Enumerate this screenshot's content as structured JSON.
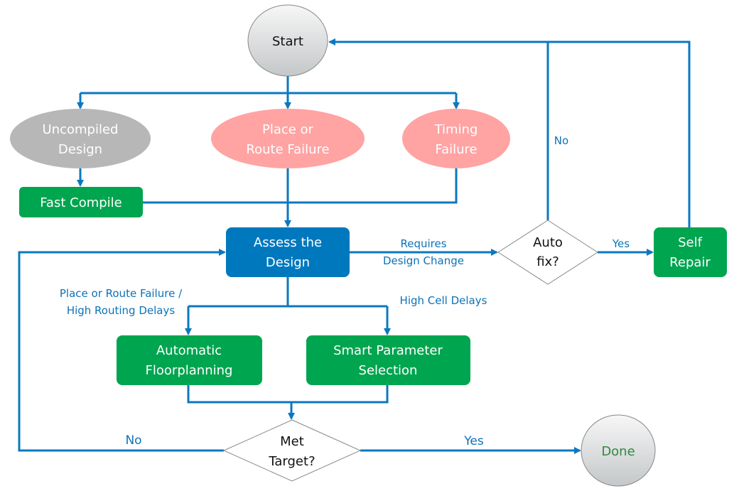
{
  "colors": {
    "connector": "#0a78c0",
    "process_green": "#00a54f",
    "process_blue": "#0078be",
    "failure_pink": "#ffa3a3",
    "uncompiled_gray": "#b7b7b7",
    "done_text": "#2e8b3e"
  },
  "nodes": {
    "start": "Start",
    "uncompiled": [
      "Uncompiled",
      "Design"
    ],
    "place_route_failure": [
      "Place or",
      "Route Failure"
    ],
    "timing_failure": [
      "Timing",
      "Failure"
    ],
    "fast_compile": "Fast Compile",
    "assess": [
      "Assess the",
      "Design"
    ],
    "auto_fix": [
      "Auto",
      "fix?"
    ],
    "self_repair": [
      "Self",
      "Repair"
    ],
    "floorplanning": [
      "Automatic",
      "Floorplanning"
    ],
    "smart_param": [
      "Smart Parameter",
      "Selection"
    ],
    "met_target": [
      "Met",
      "Target?"
    ],
    "done": "Done"
  },
  "edge_labels": {
    "requires_change": [
      "Requires",
      "Design Change"
    ],
    "autofix_yes": "Yes",
    "autofix_no": "No",
    "place_route_delays": [
      "Place or Route Failure /",
      "High Routing Delays"
    ],
    "high_cell_delays": "High Cell Delays",
    "target_no": "No",
    "target_yes": "Yes"
  }
}
